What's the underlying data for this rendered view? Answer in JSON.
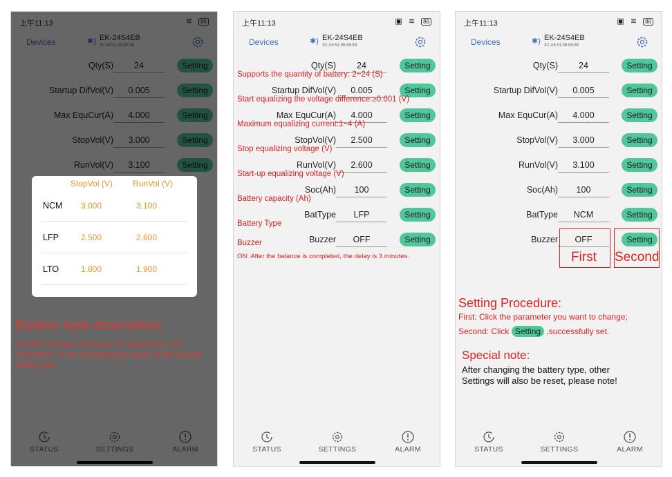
{
  "status_time": "上午11:13",
  "battery_pct": "86",
  "header": {
    "devices_label": "Devices",
    "device_name": "EK-24S4EB",
    "device_mac": "3C:A5:51:98:68:88"
  },
  "setting_label": "Setting",
  "nav": [
    {
      "label": "STATUS",
      "icon": "history-icon"
    },
    {
      "label": "SETTINGS",
      "icon": "gear-icon"
    },
    {
      "label": "ALARM",
      "icon": "alert-icon"
    }
  ],
  "params_p1": [
    {
      "label": "Qty(S)",
      "value": "24"
    },
    {
      "label": "Startup DifVol(V)",
      "value": "0.005"
    },
    {
      "label": "Max EquCur(A)",
      "value": "4.000"
    },
    {
      "label": "StopVol(V)",
      "value": "3.000"
    },
    {
      "label": "RunVol(V)",
      "value": "3.100"
    }
  ],
  "params_p2": [
    {
      "label": "Qty(S)",
      "value": "24",
      "note": "Supports the quantity of battery: 2~24 (S)"
    },
    {
      "label": "Startup DifVol(V)",
      "value": "0.005",
      "note": "Start equalizing the voltage difference:≥0.001 (V)"
    },
    {
      "label": "Max EquCur(A)",
      "value": "4.000",
      "note": "Maximum equalizing current:1~4 (A)"
    },
    {
      "label": "StopVol(V)",
      "value": "2.500",
      "note": "Stop equalizing voltage (V)"
    },
    {
      "label": "RunVol(V)",
      "value": "2.600",
      "note": "Start-up equalizing voltage (V)"
    },
    {
      "label": "Soc(Ah)",
      "value": "100",
      "note": "Battery capacity (Ah)"
    },
    {
      "label": "BatType",
      "value": "LFP",
      "note": "Battery Type"
    },
    {
      "label": "Buzzer",
      "value": "OFF",
      "note": "Buzzer"
    }
  ],
  "buzzer_on_note": "ON: After the balance is completed, the delay is 3 minutes.",
  "params_p3": [
    {
      "label": "Qty(S)",
      "value": "24"
    },
    {
      "label": "Startup DifVol(V)",
      "value": "0.005"
    },
    {
      "label": "Max EquCur(A)",
      "value": "4.000"
    },
    {
      "label": "StopVol(V)",
      "value": "3.000"
    },
    {
      "label": "RunVol(V)",
      "value": "3.100"
    },
    {
      "label": "Soc(Ah)",
      "value": "100"
    },
    {
      "label": "BatType",
      "value": "NCM"
    },
    {
      "label": "Buzzer",
      "value": "OFF"
    }
  ],
  "battery_dialog": {
    "col_stop": "StopVol (V)",
    "col_run": "RunVol (V)",
    "rows": [
      {
        "name": "NCM",
        "stop": "3.000",
        "run": "3.100"
      },
      {
        "name": "LFP",
        "stop": "2.500",
        "run": "2.600"
      },
      {
        "name": "LTO",
        "stop": "1.800",
        "run": "1.900"
      }
    ]
  },
  "battery_type_desc": {
    "title": "Battery type description:",
    "text": "The APP changes the values of \"StopVol (V)\" and \"RunVol(V)\" to the corresponding values of the selected battery type."
  },
  "procedure": {
    "first_box": "First",
    "second_box": "Second",
    "title": "Setting Procedure:",
    "line1": "First: Click the parameter you want to change;",
    "line2_pre": "Second: Click",
    "line2_btn": "Setting",
    "line2_post": ",successfully set."
  },
  "special_note": {
    "title": "Special note:",
    "text": "After changing the battery type, other Settings will also be reset, please note!"
  }
}
